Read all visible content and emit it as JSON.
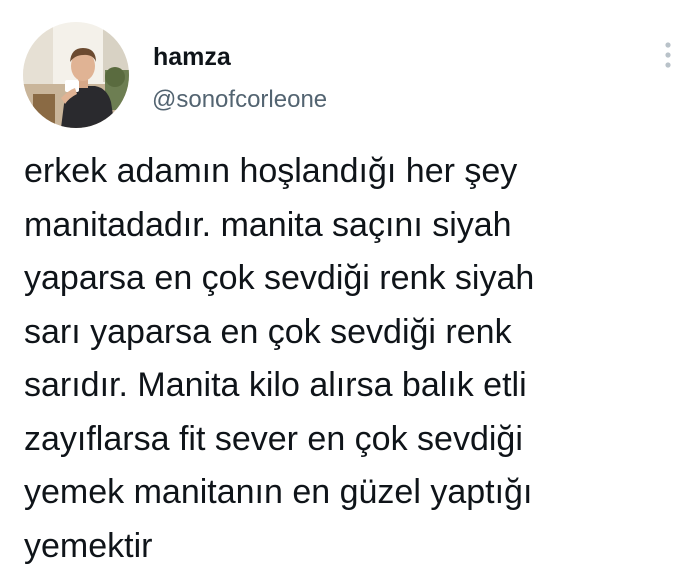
{
  "tweet": {
    "author": {
      "display_name": "hamza",
      "handle": "@sonofcorleone",
      "avatar_icon": "user-avatar-photo"
    },
    "more_icon": "more-vertical-icon",
    "text_lines": [
      "erkek adamın hoşlandığı her şey",
      "manitadadır. manita saçını siyah",
      "yaparsa en çok sevdiği renk siyah",
      "sarı yaparsa en çok sevdiği renk",
      "sarıdır. Manita kilo alırsa balık etli",
      "zayıflarsa fit sever en çok sevdiği",
      "yemek manitanın en güzel yaptığı",
      "yemektir"
    ]
  },
  "colors": {
    "text": "#0f1419",
    "secondary": "#536471",
    "background": "#ffffff"
  }
}
